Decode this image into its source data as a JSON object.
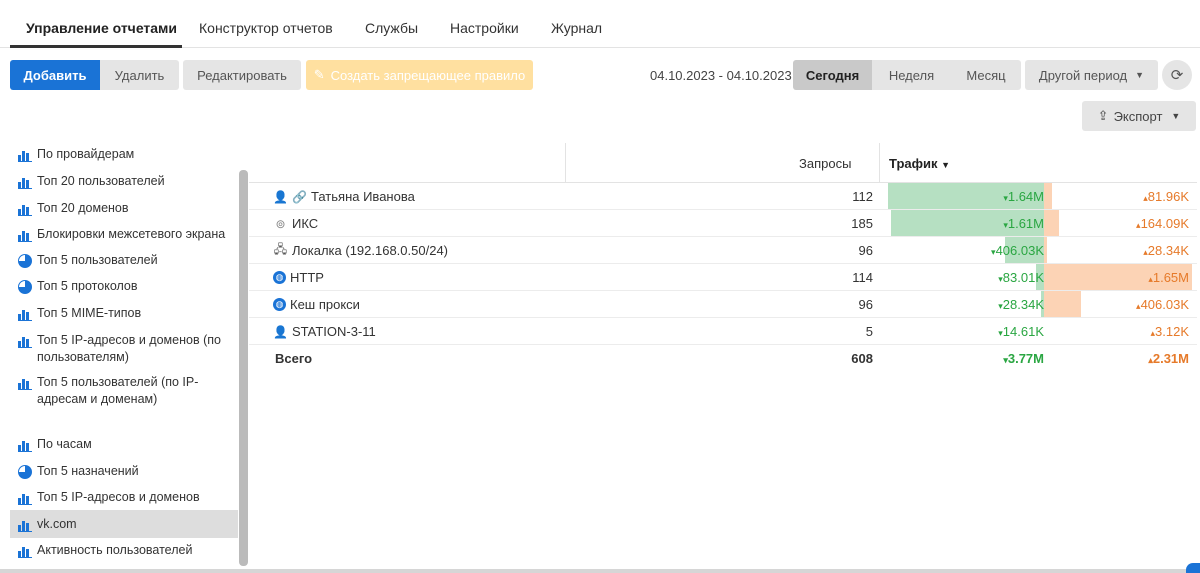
{
  "tabs": [
    "Управление отчетами",
    "Конструктор отчетов",
    "Службы",
    "Настройки",
    "Журнал"
  ],
  "toolbar": {
    "add": "Добавить",
    "delete": "Удалить",
    "edit": "Редактировать",
    "create_rule": "Создать запрещающее правило",
    "date_range": "04.10.2023 - 04.10.2023",
    "today": "Сегодня",
    "week": "Неделя",
    "month": "Месяц",
    "other_period": "Другой период",
    "export": "Экспорт"
  },
  "sidebar": {
    "items": [
      {
        "label": "По провайдерам",
        "icon": "bar-chart-icon"
      },
      {
        "label": "Топ 20 пользователей",
        "icon": "bar-chart-icon"
      },
      {
        "label": "Топ 20 доменов",
        "icon": "bar-chart-icon"
      },
      {
        "label": "Блокировки межсетевого экрана",
        "icon": "bar-chart-icon"
      },
      {
        "label": "Топ 5 пользователей",
        "icon": "pie-chart-icon"
      },
      {
        "label": "Топ 5 протоколов",
        "icon": "pie-chart-icon"
      },
      {
        "label": "Топ 5 MIME-типов",
        "icon": "bar-chart-icon"
      },
      {
        "label": "Топ 5 IP-адресов и доменов (по пользователям)",
        "icon": "bar-chart-icon"
      },
      {
        "label": "Топ 5 пользователей (по IP-адресам и доменам)",
        "icon": "bar-chart-icon"
      },
      {
        "label": "По часам",
        "icon": "bar-chart-icon"
      },
      {
        "label": "Топ 5 назначений",
        "icon": "pie-chart-icon"
      },
      {
        "label": "Топ 5 IP-адресов и доменов",
        "icon": "bar-chart-icon"
      },
      {
        "label": "vk.com",
        "icon": "bar-chart-icon",
        "selected": true
      },
      {
        "label": "Активность пользователей",
        "icon": "bar-chart-icon"
      }
    ]
  },
  "table": {
    "headers": {
      "requests": "Запросы",
      "traffic": "Трафик"
    },
    "rows": [
      {
        "name": "Татьяна Иванова",
        "icon": "user-icon",
        "extra_icon": "link-icon",
        "requests": "112",
        "in": "1.64M",
        "out": "81.96K",
        "in_frac": 0.96,
        "out_frac": 0.05
      },
      {
        "name": "ИКС",
        "icon": "iks-icon",
        "requests": "185",
        "in": "1.61M",
        "out": "164.09K",
        "in_frac": 0.94,
        "out_frac": 0.1
      },
      {
        "name": "Локалка (192.168.0.50/24)",
        "icon": "network-icon",
        "requests": "96",
        "in": "406.03K",
        "out": "28.34K",
        "in_frac": 0.24,
        "out_frac": 0.02
      },
      {
        "name": "HTTP",
        "icon": "globe-icon",
        "requests": "114",
        "in": "83.01K",
        "out": "1.65M",
        "in_frac": 0.05,
        "out_frac": 0.97
      },
      {
        "name": "Кеш прокси",
        "icon": "globe-icon",
        "requests": "96",
        "in": "28.34K",
        "out": "406.03K",
        "in_frac": 0.02,
        "out_frac": 0.24
      },
      {
        "name": "STATION-3-11",
        "icon": "user-icon",
        "requests": "5",
        "in": "14.61K",
        "out": "3.12K",
        "in_frac": 0,
        "out_frac": 0
      }
    ],
    "total": {
      "label": "Всего",
      "requests": "608",
      "in": "3.77M",
      "out": "2.31M"
    }
  }
}
